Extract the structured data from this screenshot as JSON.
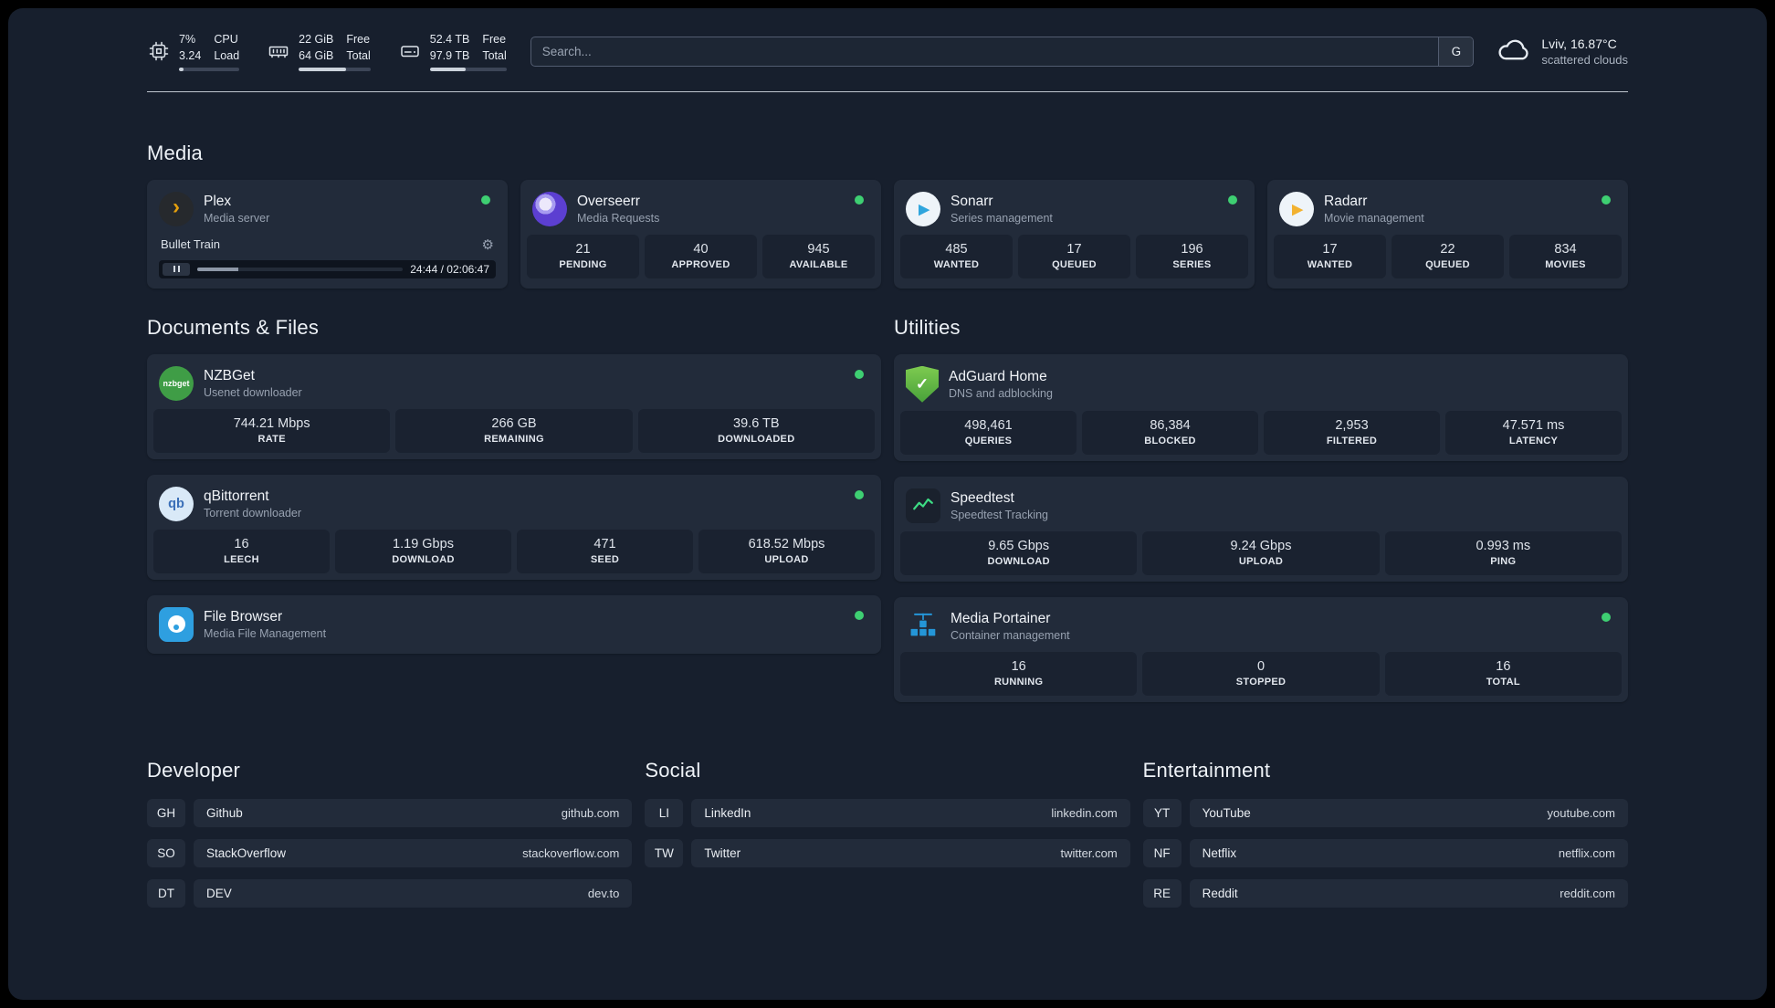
{
  "topbar": {
    "cpu": {
      "v1": "7%",
      "v2": "3.24",
      "l1": "CPU",
      "l2": "Load",
      "percent": 7
    },
    "memory": {
      "v1": "22 GiB",
      "v2": "64 GiB",
      "l1": "Free",
      "l2": "Total",
      "percent": 66
    },
    "disk": {
      "v1": "52.4 TB",
      "v2": "97.9 TB",
      "l1": "Free",
      "l2": "Total",
      "percent": 47
    },
    "search": {
      "placeholder": "Search...",
      "button": "G"
    },
    "weather": {
      "location": "Lviv, 16.87°C",
      "condition": "scattered clouds"
    }
  },
  "sections": {
    "media": {
      "title": "Media"
    },
    "documents": {
      "title": "Documents & Files"
    },
    "utilities": {
      "title": "Utilities"
    },
    "developer": {
      "title": "Developer"
    },
    "social": {
      "title": "Social"
    },
    "entertainment": {
      "title": "Entertainment"
    }
  },
  "services": {
    "plex": {
      "name": "Plex",
      "desc": "Media server",
      "track": "Bullet Train",
      "time": "24:44 / 02:06:47",
      "progress": 20
    },
    "overseerr": {
      "name": "Overseerr",
      "desc": "Media Requests",
      "stats": [
        {
          "value": "21",
          "label": "PENDING"
        },
        {
          "value": "40",
          "label": "APPROVED"
        },
        {
          "value": "945",
          "label": "AVAILABLE"
        }
      ]
    },
    "sonarr": {
      "name": "Sonarr",
      "desc": "Series management",
      "stats": [
        {
          "value": "485",
          "label": "WANTED"
        },
        {
          "value": "17",
          "label": "QUEUED"
        },
        {
          "value": "196",
          "label": "SERIES"
        }
      ]
    },
    "radarr": {
      "name": "Radarr",
      "desc": "Movie management",
      "stats": [
        {
          "value": "17",
          "label": "WANTED"
        },
        {
          "value": "22",
          "label": "QUEUED"
        },
        {
          "value": "834",
          "label": "MOVIES"
        }
      ]
    },
    "nzbget": {
      "name": "NZBGet",
      "desc": "Usenet downloader",
      "icon_text": "nzbget",
      "stats": [
        {
          "value": "744.21 Mbps",
          "label": "RATE"
        },
        {
          "value": "266 GB",
          "label": "REMAINING"
        },
        {
          "value": "39.6 TB",
          "label": "DOWNLOADED"
        }
      ]
    },
    "qbittorrent": {
      "name": "qBittorrent",
      "desc": "Torrent downloader",
      "icon_text": "qb",
      "stats": [
        {
          "value": "16",
          "label": "LEECH"
        },
        {
          "value": "1.19 Gbps",
          "label": "DOWNLOAD"
        },
        {
          "value": "471",
          "label": "SEED"
        },
        {
          "value": "618.52 Mbps",
          "label": "UPLOAD"
        }
      ]
    },
    "filebrowser": {
      "name": "File Browser",
      "desc": "Media File Management"
    },
    "adguard": {
      "name": "AdGuard Home",
      "desc": "DNS and adblocking",
      "stats": [
        {
          "value": "498,461",
          "label": "QUERIES"
        },
        {
          "value": "86,384",
          "label": "BLOCKED"
        },
        {
          "value": "2,953",
          "label": "FILTERED"
        },
        {
          "value": "47.571 ms",
          "label": "LATENCY"
        }
      ]
    },
    "speedtest": {
      "name": "Speedtest",
      "desc": "Speedtest Tracking",
      "stats": [
        {
          "value": "9.65 Gbps",
          "label": "DOWNLOAD"
        },
        {
          "value": "9.24 Gbps",
          "label": "UPLOAD"
        },
        {
          "value": "0.993 ms",
          "label": "PING"
        }
      ]
    },
    "portainer": {
      "name": "Media Portainer",
      "desc": "Container management",
      "stats": [
        {
          "value": "16",
          "label": "RUNNING"
        },
        {
          "value": "0",
          "label": "STOPPED"
        },
        {
          "value": "16",
          "label": "TOTAL"
        }
      ]
    }
  },
  "bookmarks": {
    "developer": [
      {
        "abbr": "GH",
        "name": "Github",
        "url": "github.com"
      },
      {
        "abbr": "SO",
        "name": "StackOverflow",
        "url": "stackoverflow.com"
      },
      {
        "abbr": "DT",
        "name": "DEV",
        "url": "dev.to"
      }
    ],
    "social": [
      {
        "abbr": "LI",
        "name": "LinkedIn",
        "url": "linkedin.com"
      },
      {
        "abbr": "TW",
        "name": "Twitter",
        "url": "twitter.com"
      }
    ],
    "entertainment": [
      {
        "abbr": "YT",
        "name": "YouTube",
        "url": "youtube.com"
      },
      {
        "abbr": "NF",
        "name": "Netflix",
        "url": "netflix.com"
      },
      {
        "abbr": "RE",
        "name": "Reddit",
        "url": "reddit.com"
      }
    ]
  },
  "icons": {
    "gear": "⚙",
    "play": "▶",
    "chevron": "›",
    "check": "✓"
  },
  "colors": {
    "status_green": "#3ecf72",
    "background": "#171f2d",
    "card": "#222b3a"
  }
}
